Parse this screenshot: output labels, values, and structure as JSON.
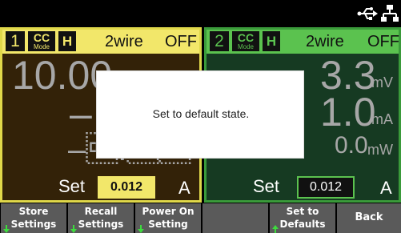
{
  "status_bar": {
    "icons": [
      "usb-icon",
      "lan-icon"
    ]
  },
  "channels": [
    {
      "number": "1",
      "mode_value": "CC",
      "mode_label": "Mode",
      "range": "H",
      "sense": "2wire",
      "output_state": "OFF",
      "voltage_display": "10.00",
      "current_display": "–",
      "power_display": "–\u0010.\u0010\u0010",
      "set_label": "Set",
      "set_value": "0.012",
      "set_unit": "A",
      "colors": {
        "accent": "#f2e76a",
        "background": "#332208"
      }
    },
    {
      "number": "2",
      "mode_value": "CC",
      "mode_label": "Mode",
      "range": "H",
      "sense": "2wire",
      "output_state": "OFF",
      "voltage_display": "3.3",
      "voltage_unit": "mV",
      "current_display": "1.0",
      "current_unit": "mA",
      "power_display": "0.0",
      "power_unit": "mW",
      "set_label": "Set",
      "set_value": "0.012",
      "set_unit": "A",
      "colors": {
        "accent": "#5bc24f",
        "background": "#163a22"
      }
    }
  ],
  "dialog": {
    "message": "Set to default state."
  },
  "softkeys": [
    {
      "line1": "Store",
      "line2": "Settings",
      "arrow": "down"
    },
    {
      "line1": "Recall",
      "line2": "Settings",
      "arrow": "down"
    },
    {
      "line1": "Power On",
      "line2": "Setting",
      "arrow": "down"
    },
    {
      "line1": "",
      "line2": "",
      "arrow": ""
    },
    {
      "line1": "Set to",
      "line2": "Defaults",
      "arrow": "up"
    },
    {
      "line1": "Back",
      "line2": "",
      "arrow": ""
    }
  ]
}
